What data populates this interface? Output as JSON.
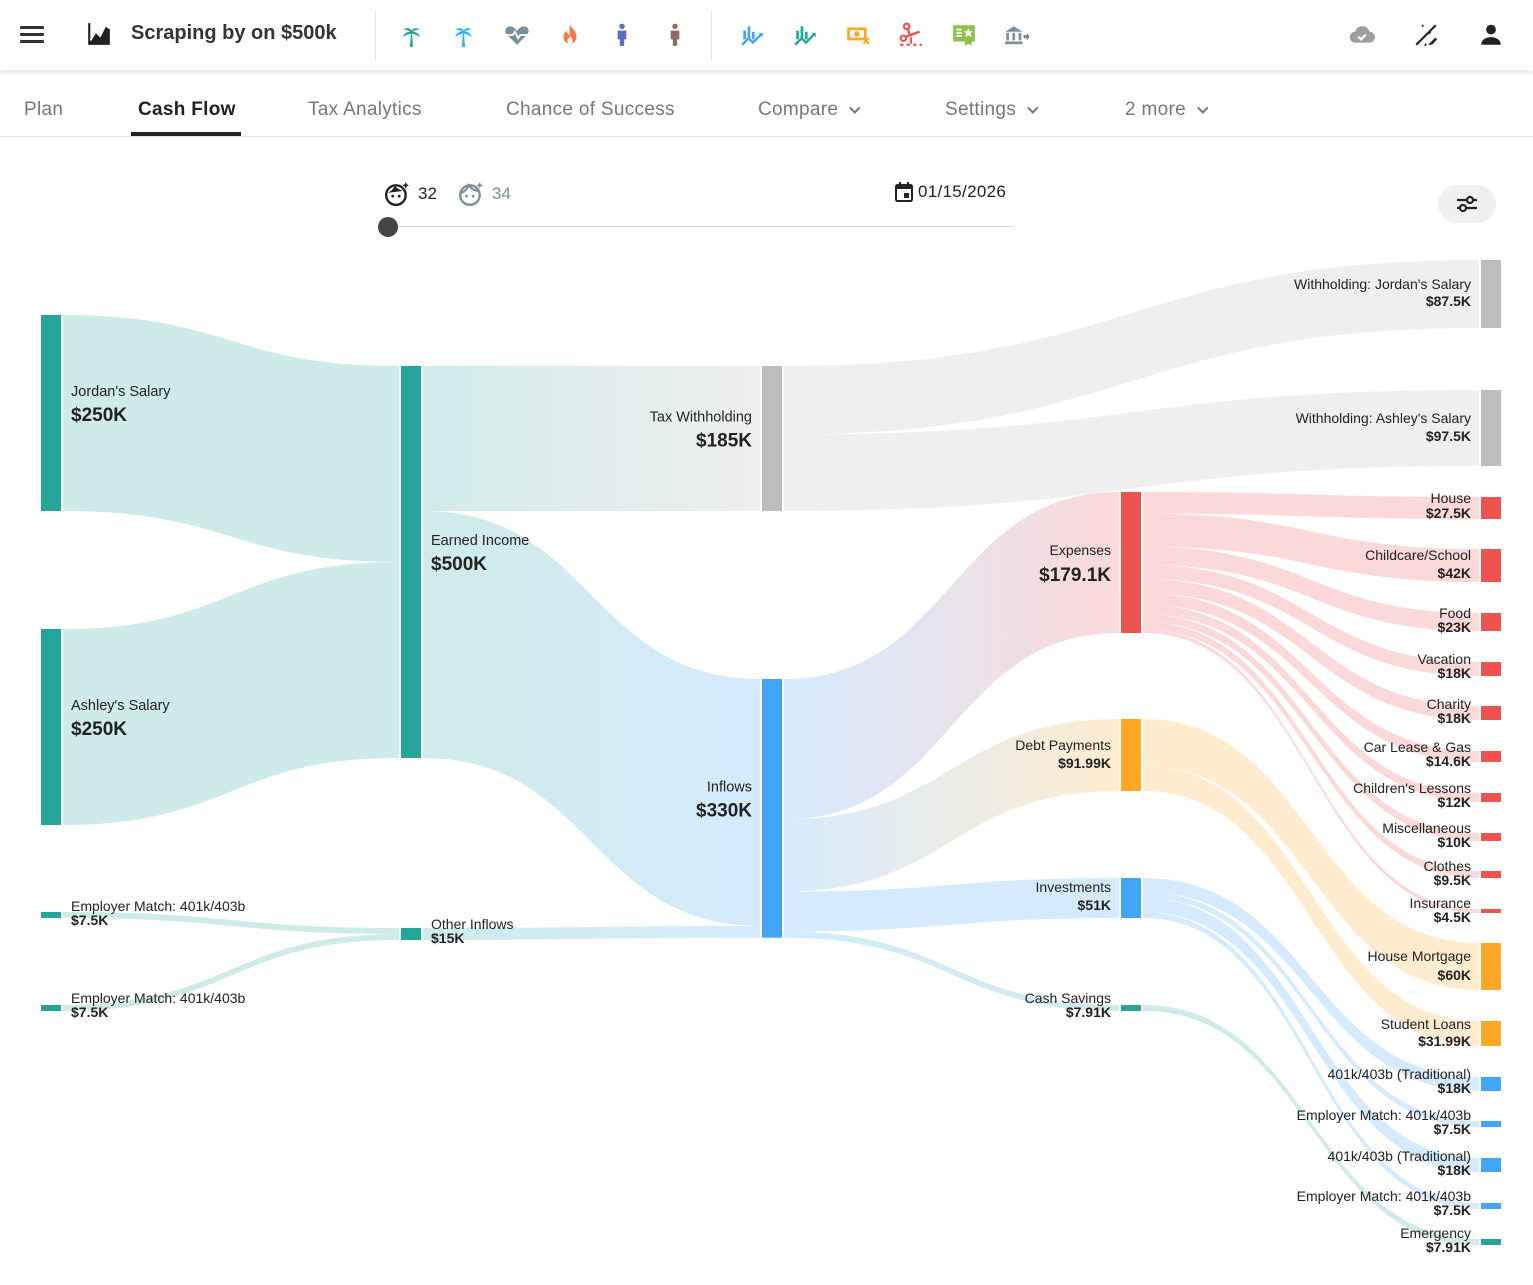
{
  "app": {
    "title": "Scraping by on $500k",
    "toolbar_icons": [
      {
        "name": "palm-tree-teal-icon",
        "color": "#26a69a"
      },
      {
        "name": "palm-tree-blue-icon",
        "color": "#29b6f6"
      },
      {
        "name": "heart-pulse-icon",
        "color": "#78909c"
      },
      {
        "name": "fire-icon",
        "color": "#ff7043"
      },
      {
        "name": "person-blue-icon",
        "color": "#5c6bc0"
      },
      {
        "name": "person-brown-icon",
        "color": "#8d6e63"
      },
      {
        "name": "chart-growth-blue-icon",
        "color": "#42a5f5"
      },
      {
        "name": "chart-growth-teal-icon",
        "color": "#26a69a"
      },
      {
        "name": "cash-off-icon",
        "color": "#ffa726"
      },
      {
        "name": "scissors-cut-icon",
        "color": "#ef5350"
      },
      {
        "name": "certificate-icon",
        "color": "#8bc34a"
      },
      {
        "name": "bank-transfer-icon",
        "color": "#78909c"
      }
    ],
    "right_icons": [
      {
        "name": "cloud-check-icon",
        "color": "#9e9e9e"
      },
      {
        "name": "theme-toggle-icon",
        "color": "#222222"
      },
      {
        "name": "account-icon",
        "color": "#222222"
      }
    ]
  },
  "tabs": [
    {
      "label": "Plan",
      "active": false,
      "dropdown": false
    },
    {
      "label": "Cash Flow",
      "active": true,
      "dropdown": false
    },
    {
      "label": "Tax Analytics",
      "active": false,
      "dropdown": false
    },
    {
      "label": "Chance of Success",
      "active": false,
      "dropdown": false
    },
    {
      "label": "Compare",
      "active": false,
      "dropdown": true
    },
    {
      "label": "Settings",
      "active": false,
      "dropdown": true
    },
    {
      "label": "2 more",
      "active": false,
      "dropdown": true
    }
  ],
  "controls": {
    "age_primary": "32",
    "age_secondary": "34",
    "date": "01/15/2026",
    "timeline_position": 0
  },
  "chart_data": {
    "type": "sankey",
    "title": "Cash Flow",
    "colors": {
      "income": "#26a69a",
      "tax": "#bdbdbd",
      "inflows": "#42a5f5",
      "expenses": "#ef5350",
      "debt": "#ffa726",
      "investments": "#42a5f5",
      "savings": "#26a69a"
    },
    "nodes": [
      {
        "id": "jordan",
        "label": "Jordan's Salary",
        "value_label": "$250K",
        "value": 250,
        "group": "income"
      },
      {
        "id": "ashley",
        "label": "Ashley's Salary",
        "value_label": "$250K",
        "value": 250,
        "group": "income"
      },
      {
        "id": "match1",
        "label": "Employer Match: 401k/403b",
        "value_label": "$7.5K",
        "value": 7.5,
        "group": "income"
      },
      {
        "id": "match2",
        "label": "Employer Match: 401k/403b",
        "value_label": "$7.5K",
        "value": 7.5,
        "group": "income"
      },
      {
        "id": "earned",
        "label": "Earned Income",
        "value_label": "$500K",
        "value": 500,
        "group": "income"
      },
      {
        "id": "other",
        "label": "Other Inflows",
        "value_label": "$15K",
        "value": 15,
        "group": "income"
      },
      {
        "id": "taxw",
        "label": "Tax Withholding",
        "value_label": "$185K",
        "value": 185,
        "group": "tax"
      },
      {
        "id": "inflows",
        "label": "Inflows",
        "value_label": "$330K",
        "value": 330,
        "group": "inflows"
      },
      {
        "id": "wjordan",
        "label": "Withholding: Jordan's Salary",
        "value_label": "$87.5K",
        "value": 87.5,
        "group": "tax"
      },
      {
        "id": "washley",
        "label": "Withholding: Ashley's Salary",
        "value_label": "$97.5K",
        "value": 97.5,
        "group": "tax"
      },
      {
        "id": "expenses",
        "label": "Expenses",
        "value_label": "$179.1K",
        "value": 179.1,
        "group": "expenses"
      },
      {
        "id": "debt",
        "label": "Debt Payments",
        "value_label": "$91.99K",
        "value": 91.99,
        "group": "debt"
      },
      {
        "id": "invest",
        "label": "Investments",
        "value_label": "$51K",
        "value": 51,
        "group": "investments"
      },
      {
        "id": "cash",
        "label": "Cash Savings",
        "value_label": "$7.91K",
        "value": 7.91,
        "group": "savings"
      },
      {
        "id": "house",
        "label": "House",
        "value_label": "$27.5K",
        "value": 27.5,
        "group": "expenses"
      },
      {
        "id": "childcare",
        "label": "Childcare/School",
        "value_label": "$42K",
        "value": 42,
        "group": "expenses"
      },
      {
        "id": "food",
        "label": "Food",
        "value_label": "$23K",
        "value": 23,
        "group": "expenses"
      },
      {
        "id": "vacation",
        "label": "Vacation",
        "value_label": "$18K",
        "value": 18,
        "group": "expenses"
      },
      {
        "id": "charity",
        "label": "Charity",
        "value_label": "$18K",
        "value": 18,
        "group": "expenses"
      },
      {
        "id": "car",
        "label": "Car Lease & Gas",
        "value_label": "$14.6K",
        "value": 14.6,
        "group": "expenses"
      },
      {
        "id": "lessons",
        "label": "Children's Lessons",
        "value_label": "$12K",
        "value": 12,
        "group": "expenses"
      },
      {
        "id": "misc",
        "label": "Miscellaneous",
        "value_label": "$10K",
        "value": 10,
        "group": "expenses"
      },
      {
        "id": "clothes",
        "label": "Clothes",
        "value_label": "$9.5K",
        "value": 9.5,
        "group": "expenses"
      },
      {
        "id": "insurance",
        "label": "Insurance",
        "value_label": "$4.5K",
        "value": 4.5,
        "group": "expenses"
      },
      {
        "id": "mortgage",
        "label": "House Mortgage",
        "value_label": "$60K",
        "value": 60,
        "group": "debt"
      },
      {
        "id": "student",
        "label": "Student Loans",
        "value_label": "$31.99K",
        "value": 31.99,
        "group": "debt"
      },
      {
        "id": "trad1",
        "label": "401k/403b (Traditional)",
        "value_label": "$18K",
        "value": 18,
        "group": "investments"
      },
      {
        "id": "em1",
        "label": "Employer Match: 401k/403b",
        "value_label": "$7.5K",
        "value": 7.5,
        "group": "investments"
      },
      {
        "id": "trad2",
        "label": "401k/403b (Traditional)",
        "value_label": "$18K",
        "value": 18,
        "group": "investments"
      },
      {
        "id": "em2",
        "label": "Employer Match: 401k/403b",
        "value_label": "$7.5K",
        "value": 7.5,
        "group": "investments"
      },
      {
        "id": "emergency",
        "label": "Emergency",
        "value_label": "$7.91K",
        "value": 7.91,
        "group": "savings"
      }
    ],
    "links": [
      {
        "source": "jordan",
        "target": "earned",
        "value": 250
      },
      {
        "source": "ashley",
        "target": "earned",
        "value": 250
      },
      {
        "source": "match1",
        "target": "other",
        "value": 7.5
      },
      {
        "source": "match2",
        "target": "other",
        "value": 7.5
      },
      {
        "source": "earned",
        "target": "taxw",
        "value": 185
      },
      {
        "source": "earned",
        "target": "inflows",
        "value": 315
      },
      {
        "source": "other",
        "target": "inflows",
        "value": 15
      },
      {
        "source": "taxw",
        "target": "wjordan",
        "value": 87.5
      },
      {
        "source": "taxw",
        "target": "washley",
        "value": 97.5
      },
      {
        "source": "inflows",
        "target": "expenses",
        "value": 179.1
      },
      {
        "source": "inflows",
        "target": "debt",
        "value": 91.99
      },
      {
        "source": "inflows",
        "target": "invest",
        "value": 51
      },
      {
        "source": "inflows",
        "target": "cash",
        "value": 7.91
      },
      {
        "source": "expenses",
        "target": "house",
        "value": 27.5
      },
      {
        "source": "expenses",
        "target": "childcare",
        "value": 42
      },
      {
        "source": "expenses",
        "target": "food",
        "value": 23
      },
      {
        "source": "expenses",
        "target": "vacation",
        "value": 18
      },
      {
        "source": "expenses",
        "target": "charity",
        "value": 18
      },
      {
        "source": "expenses",
        "target": "car",
        "value": 14.6
      },
      {
        "source": "expenses",
        "target": "lessons",
        "value": 12
      },
      {
        "source": "expenses",
        "target": "misc",
        "value": 10
      },
      {
        "source": "expenses",
        "target": "clothes",
        "value": 9.5
      },
      {
        "source": "expenses",
        "target": "insurance",
        "value": 4.5
      },
      {
        "source": "debt",
        "target": "mortgage",
        "value": 60
      },
      {
        "source": "debt",
        "target": "student",
        "value": 31.99
      },
      {
        "source": "invest",
        "target": "trad1",
        "value": 18
      },
      {
        "source": "invest",
        "target": "em1",
        "value": 7.5
      },
      {
        "source": "invest",
        "target": "trad2",
        "value": 18
      },
      {
        "source": "invest",
        "target": "em2",
        "value": 7.5
      },
      {
        "source": "cash",
        "target": "emergency",
        "value": 7.91
      }
    ]
  }
}
